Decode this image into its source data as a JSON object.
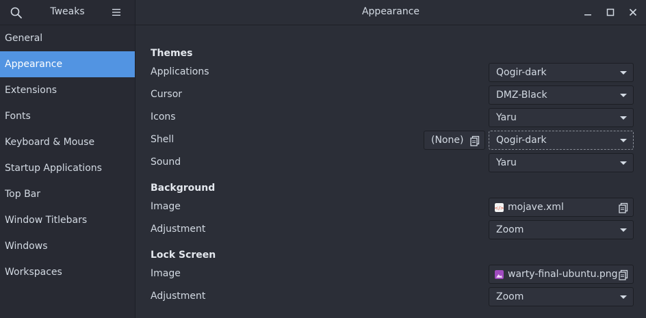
{
  "sidebar": {
    "title": "Tweaks",
    "items": [
      {
        "label": "General"
      },
      {
        "label": "Appearance",
        "active": true
      },
      {
        "label": "Extensions"
      },
      {
        "label": "Fonts"
      },
      {
        "label": "Keyboard & Mouse"
      },
      {
        "label": "Startup Applications"
      },
      {
        "label": "Top Bar"
      },
      {
        "label": "Window Titlebars"
      },
      {
        "label": "Windows"
      },
      {
        "label": "Workspaces"
      }
    ]
  },
  "header": {
    "title": "Appearance"
  },
  "themes": {
    "title": "Themes",
    "applications": {
      "label": "Applications",
      "value": "Qogir-dark"
    },
    "cursor": {
      "label": "Cursor",
      "value": "DMZ-Black"
    },
    "icons": {
      "label": "Icons",
      "value": "Yaru"
    },
    "shell": {
      "label": "Shell",
      "none_label": "(None)",
      "value": "Qogir-dark"
    },
    "sound": {
      "label": "Sound",
      "value": "Yaru"
    }
  },
  "background": {
    "title": "Background",
    "image": {
      "label": "Image",
      "value": "mojave.xml"
    },
    "adjustment": {
      "label": "Adjustment",
      "value": "Zoom"
    }
  },
  "lock_screen": {
    "title": "Lock Screen",
    "image": {
      "label": "Image",
      "value": "warty-final-ubuntu.png"
    },
    "adjustment": {
      "label": "Adjustment",
      "value": "Zoom"
    }
  },
  "colors": {
    "accent": "#5294e2",
    "bg": "#2b2e37",
    "sidebar_bg": "#282a33",
    "xml_icon": "#f4f4f4",
    "image_icon": "#a04bc0"
  }
}
